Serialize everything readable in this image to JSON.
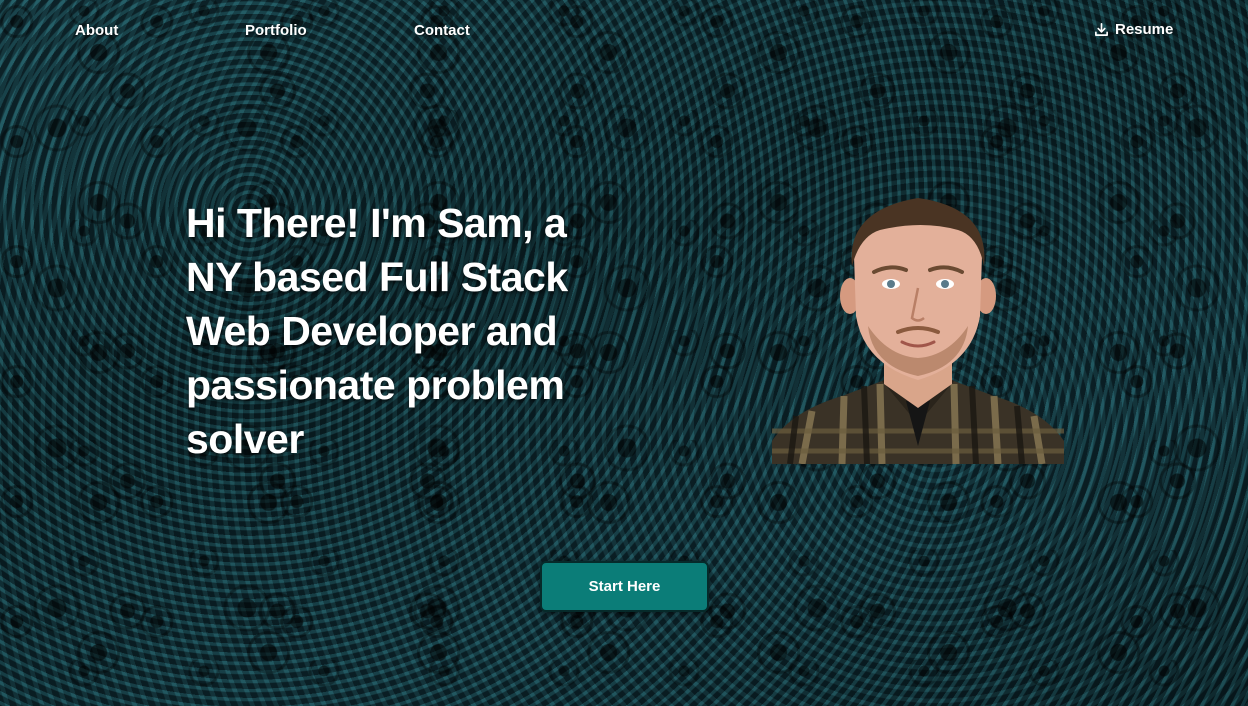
{
  "nav": {
    "links": [
      {
        "label": "About"
      },
      {
        "label": "Portfolio"
      },
      {
        "label": "Contact"
      }
    ],
    "resume": {
      "label": "Resume",
      "icon": "download-icon"
    }
  },
  "hero": {
    "headline": "Hi There! I'm Sam, a NY based Full Stack Web Developer and passionate problem solver",
    "cta_label": "Start Here"
  },
  "theme": {
    "accent": "#0b7d78",
    "text": "#ffffff"
  }
}
